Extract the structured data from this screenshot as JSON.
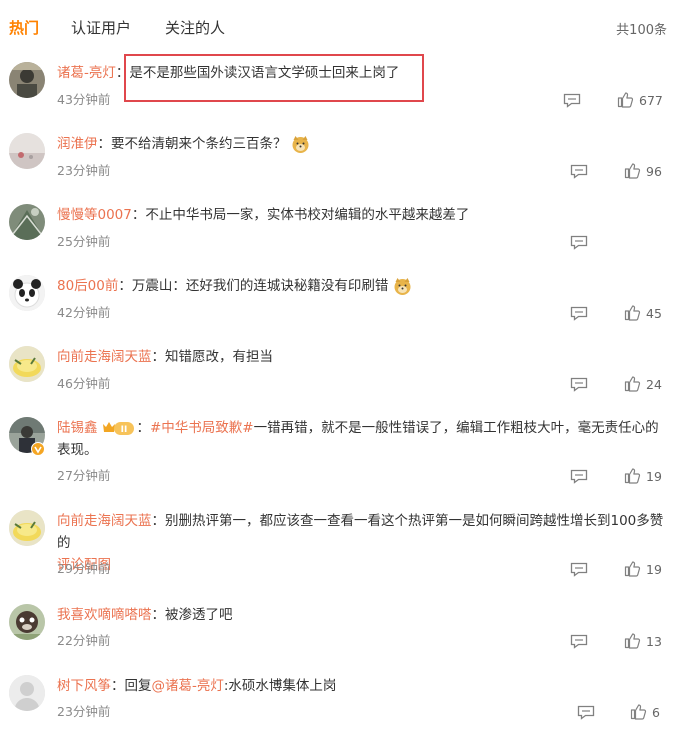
{
  "tabs": [
    {
      "label": "热门",
      "active": true
    },
    {
      "label": "认证用户",
      "active": false
    },
    {
      "label": "关注的人",
      "active": false
    }
  ],
  "total_count": "共100条",
  "accent_color": "#ff8200",
  "username_color": "#eb7350",
  "comments": [
    {
      "user": "诸葛-亮灯",
      "sep": "：",
      "text": "是不是那些国外读汉语言文学硕士回来上岗了",
      "time": "43分钟前",
      "likes": "677",
      "highlighted": true
    },
    {
      "user": "润淮伊",
      "sep": "：",
      "text": "要不给清朝来个条约三百条？",
      "emoji": "doge",
      "time": "23分钟前",
      "likes": "96"
    },
    {
      "user": "慢慢等0007",
      "sep": "：",
      "text": "不止中华书局一家，实体书校对编辑的水平越来越差了",
      "time": "25分钟前",
      "likes": ""
    },
    {
      "user": "80后00前",
      "sep": "：",
      "text": "万震山：还好我们的连城诀秘籍没有印刷错",
      "emoji": "doge",
      "time": "42分钟前",
      "likes": "45"
    },
    {
      "user": "向前走海阔天蓝",
      "sep": "：",
      "text": "知错愿改，有担当",
      "time": "46分钟前",
      "likes": "24"
    },
    {
      "user": "陆锡鑫",
      "badge": "II",
      "sep": "：",
      "topic": "#中华书局致歉#",
      "text": "一错再错，就不是一般性错误了，编辑工作粗枝大叶，毫无责任心的",
      "text2": "表现。",
      "time": "27分钟前",
      "likes": "19"
    },
    {
      "user": "向前走海阔天蓝",
      "sep": "：",
      "text": "别删热评第一，都应该查一查看一看这个热评第一是如何瞬间跨越性增长到100多赞的",
      "link2": "评论配图",
      "time": "29分钟前",
      "likes": "19"
    },
    {
      "user": "我喜欢嘀嘀嗒嗒",
      "sep": "：",
      "text": "被渗透了吧",
      "time": "22分钟前",
      "likes": "13"
    },
    {
      "user": "树下风筝",
      "sep": "：",
      "text_prefix": "回复",
      "mention": "@诸葛-亮灯",
      "text": ":水硕水博集体上岗",
      "time": "23分钟前",
      "likes": "6"
    }
  ]
}
